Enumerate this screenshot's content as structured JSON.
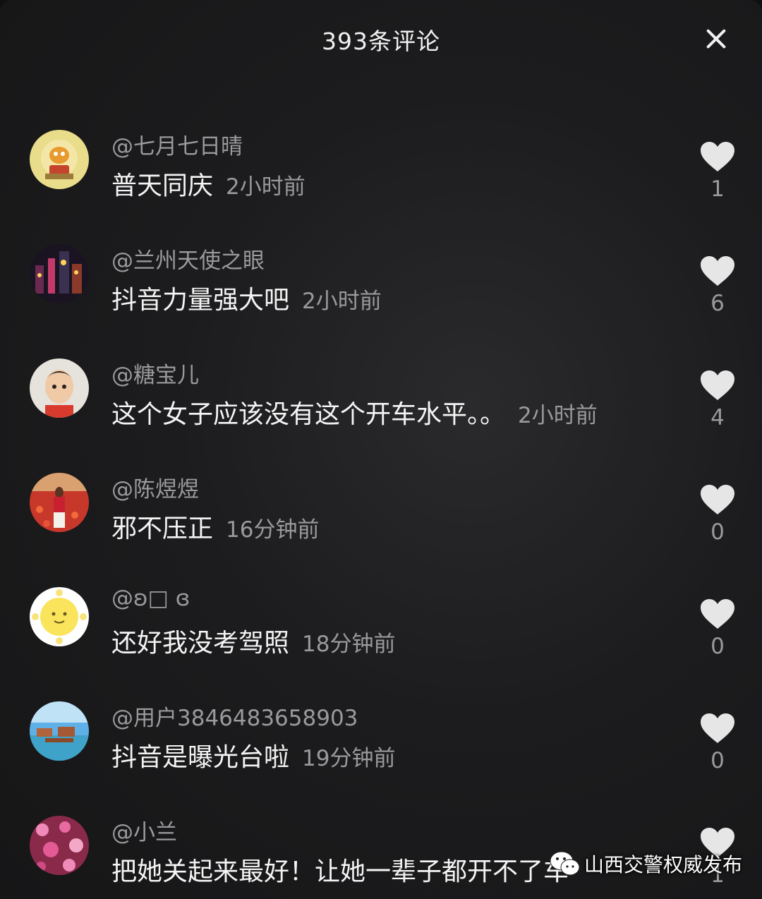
{
  "header": {
    "title": "393条评论",
    "close_icon": "close-icon"
  },
  "comments": [
    {
      "author": "@七月七日晴",
      "text": "普天同庆",
      "time": "2小时前",
      "likes": "1",
      "avatar_icon": "garfield-avatar"
    },
    {
      "author": "@兰州天使之眼",
      "text": "抖音力量强大吧",
      "time": "2小时前",
      "likes": "6",
      "avatar_icon": "city-night-avatar"
    },
    {
      "author": "@糖宝儿",
      "text": "这个女子应该没有这个开车水平。。",
      "time": "2小时前",
      "likes": "4",
      "avatar_icon": "child-photo-avatar"
    },
    {
      "author": "@陈煜煜",
      "text": "邪不压正",
      "time": "16分钟前",
      "likes": "0",
      "avatar_icon": "flower-field-avatar"
    },
    {
      "author": "@ʚ□ ɞ",
      "text": "还好我没考驾照",
      "time": "18分钟前",
      "likes": "0",
      "avatar_icon": "smiley-sun-avatar"
    },
    {
      "author": "@用户3846483658903",
      "text": "抖音是曝光台啦",
      "time": "19分钟前",
      "likes": "0",
      "avatar_icon": "beach-villa-avatar"
    },
    {
      "author": "@小兰",
      "text": "把她关起来最好！让她一辈子都开不了车",
      "time": "",
      "likes": "1",
      "avatar_icon": "pink-flowers-avatar"
    }
  ],
  "watermark": {
    "text": "山西交警权威发布",
    "icon": "wechat-icon"
  }
}
